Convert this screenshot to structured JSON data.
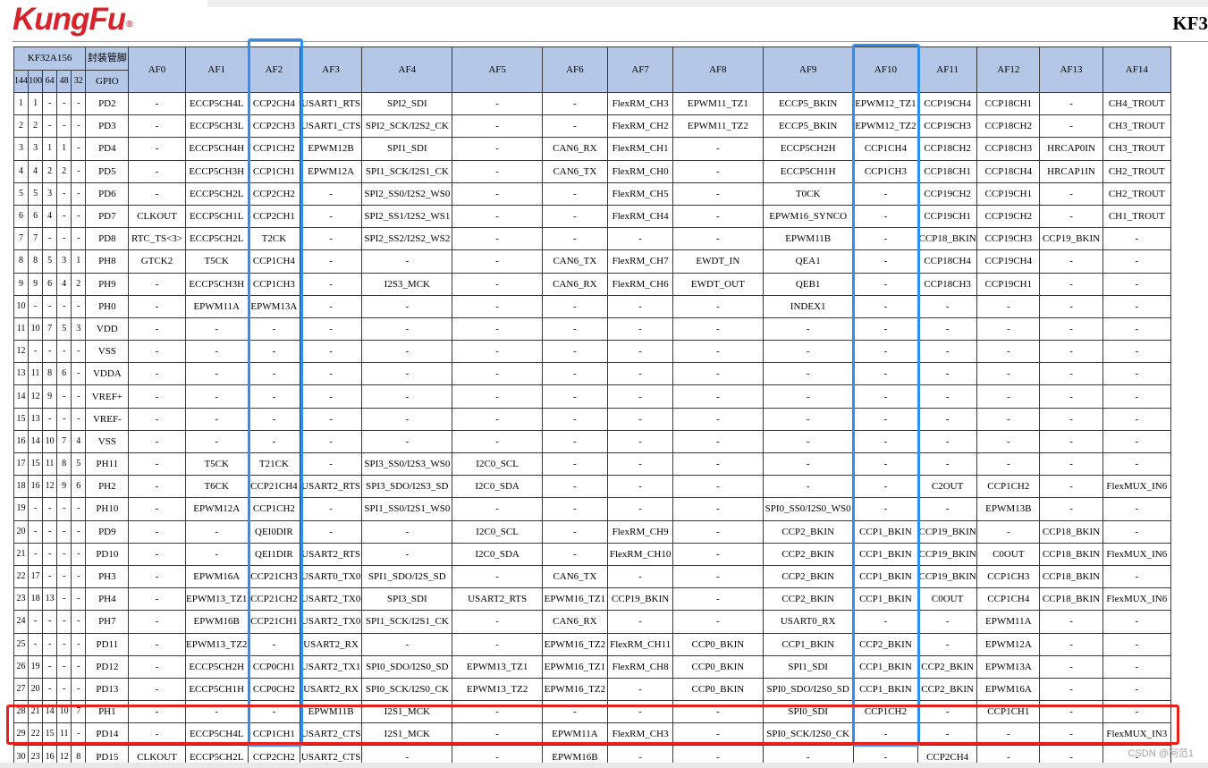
{
  "header": {
    "logo": "KungFu",
    "logo_mark": "®",
    "model": "KF3"
  },
  "table": {
    "package_title": "KF32A156",
    "pin_header_title": "封装管脚",
    "pin_columns": [
      "144",
      "100",
      "64",
      "48",
      "32"
    ],
    "gpio_header": "GPIO",
    "af_headers": [
      "AF0",
      "AF1",
      "AF2",
      "AF3",
      "AF4",
      "AF5",
      "AF6",
      "AF7",
      "AF8",
      "AF9",
      "AF10",
      "AF11",
      "AF12",
      "AF13",
      "AF14"
    ],
    "rows": [
      {
        "pins": [
          "1",
          "1",
          "-",
          "-",
          "-"
        ],
        "gpio": "PD2",
        "af": [
          "-",
          "ECCP5CH4L",
          "CCP2CH4",
          "USART1_RTS",
          "SPI2_SDI",
          "-",
          "-",
          "FlexRM_CH3",
          "EPWM11_TZ1",
          "ECCP5_BKIN",
          "EPWM12_TZ1",
          "CCP19CH4",
          "CCP18CH1",
          "-",
          "CH4_TROUT"
        ]
      },
      {
        "pins": [
          "2",
          "2",
          "-",
          "-",
          "-"
        ],
        "gpio": "PD3",
        "af": [
          "-",
          "ECCP5CH3L",
          "CCP2CH3",
          "USART1_CTS",
          "SPI2_SCK/I2S2_CK",
          "-",
          "-",
          "FlexRM_CH2",
          "EPWM11_TZ2",
          "ECCP5_BKIN",
          "EPWM12_TZ2",
          "CCP19CH3",
          "CCP18CH2",
          "-",
          "CH3_TROUT"
        ]
      },
      {
        "pins": [
          "3",
          "3",
          "1",
          "1",
          "-"
        ],
        "gpio": "PD4",
        "af": [
          "-",
          "ECCP5CH4H",
          "CCP1CH2",
          "EPWM12B",
          "SPI1_SDI",
          "-",
          "CAN6_RX",
          "FlexRM_CH1",
          "-",
          "ECCP5CH2H",
          "CCP1CH4",
          "CCP18CH2",
          "CCP18CH3",
          "HRCAP0IN",
          "CH3_TROUT"
        ]
      },
      {
        "pins": [
          "4",
          "4",
          "2",
          "2",
          "-"
        ],
        "gpio": "PD5",
        "af": [
          "-",
          "ECCP5CH3H",
          "CCP1CH1",
          "EPWM12A",
          "SPI1_SCK/I2S1_CK",
          "-",
          "CAN6_TX",
          "FlexRM_CH0",
          "-",
          "ECCP5CH1H",
          "CCP1CH3",
          "CCP18CH1",
          "CCP18CH4",
          "HRCAP1IN",
          "CH2_TROUT"
        ]
      },
      {
        "pins": [
          "5",
          "5",
          "3",
          "-",
          "-"
        ],
        "gpio": "PD6",
        "af": [
          "-",
          "ECCP5CH2L",
          "CCP2CH2",
          "-",
          "SPI2_SS0/I2S2_WS0",
          "-",
          "-",
          "FlexRM_CH5",
          "-",
          "T0CK",
          "-",
          "CCP19CH2",
          "CCP19CH1",
          "-",
          "CH2_TROUT"
        ]
      },
      {
        "pins": [
          "6",
          "6",
          "4",
          "-",
          "-"
        ],
        "gpio": "PD7",
        "af": [
          "CLKOUT",
          "ECCP5CH1L",
          "CCP2CH1",
          "-",
          "SPI2_SS1/I2S2_WS1",
          "-",
          "-",
          "FlexRM_CH4",
          "-",
          "EPWM16_SYNCO",
          "-",
          "CCP19CH1",
          "CCP19CH2",
          "-",
          "CH1_TROUT"
        ]
      },
      {
        "pins": [
          "7",
          "7",
          "-",
          "-",
          "-"
        ],
        "gpio": "PD8",
        "af": [
          "RTC_TS<3>",
          "ECCP5CH2L",
          "T2CK",
          "-",
          "SPI2_SS2/I2S2_WS2",
          "-",
          "-",
          "-",
          "-",
          "EPWM11B",
          "-",
          "CCP18_BKIN",
          "CCP19CH3",
          "CCP19_BKIN",
          "-"
        ]
      },
      {
        "pins": [
          "8",
          "8",
          "5",
          "3",
          "1"
        ],
        "gpio": "PH8",
        "af": [
          "GTCK2",
          "T5CK",
          "CCP1CH4",
          "-",
          "-",
          "-",
          "CAN6_TX",
          "FlexRM_CH7",
          "EWDT_IN",
          "QEA1",
          "-",
          "CCP18CH4",
          "CCP19CH4",
          "-",
          "-"
        ]
      },
      {
        "pins": [
          "9",
          "9",
          "6",
          "4",
          "2"
        ],
        "gpio": "PH9",
        "af": [
          "-",
          "ECCP5CH3H",
          "CCP1CH3",
          "-",
          "I2S3_MCK",
          "-",
          "CAN6_RX",
          "FlexRM_CH6",
          "EWDT_OUT",
          "QEB1",
          "-",
          "CCP18CH3",
          "CCP19CH1",
          "-",
          "-"
        ]
      },
      {
        "pins": [
          "10",
          "-",
          "-",
          "-",
          "-"
        ],
        "gpio": "PH0",
        "af": [
          "-",
          "EPWM11A",
          "EPWM13A",
          "-",
          "-",
          "-",
          "-",
          "-",
          "-",
          "INDEX1",
          "-",
          "-",
          "-",
          "-",
          "-"
        ]
      },
      {
        "pins": [
          "11",
          "10",
          "7",
          "5",
          "3"
        ],
        "gpio": "VDD",
        "af": [
          "-",
          "-",
          "-",
          "-",
          "-",
          "-",
          "-",
          "-",
          "-",
          "-",
          "-",
          "-",
          "-",
          "-",
          "-"
        ]
      },
      {
        "pins": [
          "12",
          "-",
          "-",
          "-",
          "-"
        ],
        "gpio": "VSS",
        "af": [
          "-",
          "-",
          "-",
          "-",
          "-",
          "-",
          "-",
          "-",
          "-",
          "-",
          "-",
          "-",
          "-",
          "-",
          "-"
        ]
      },
      {
        "pins": [
          "13",
          "11",
          "8",
          "6",
          "-"
        ],
        "gpio": "VDDA",
        "af": [
          "-",
          "-",
          "-",
          "-",
          "-",
          "-",
          "-",
          "-",
          "-",
          "-",
          "-",
          "-",
          "-",
          "-",
          "-"
        ]
      },
      {
        "pins": [
          "14",
          "12",
          "9",
          "-",
          "-"
        ],
        "gpio": "VREF+",
        "af": [
          "-",
          "-",
          "-",
          "-",
          "-",
          "-",
          "-",
          "-",
          "-",
          "-",
          "-",
          "-",
          "-",
          "-",
          "-"
        ]
      },
      {
        "pins": [
          "15",
          "13",
          "-",
          "-",
          "-"
        ],
        "gpio": "VREF-",
        "af": [
          "-",
          "-",
          "-",
          "-",
          "-",
          "-",
          "-",
          "-",
          "-",
          "-",
          "-",
          "-",
          "-",
          "-",
          "-"
        ]
      },
      {
        "pins": [
          "16",
          "14",
          "10",
          "7",
          "4"
        ],
        "gpio": "VSS",
        "af": [
          "-",
          "-",
          "-",
          "-",
          "-",
          "-",
          "-",
          "-",
          "-",
          "-",
          "-",
          "-",
          "-",
          "-",
          "-"
        ]
      },
      {
        "pins": [
          "17",
          "15",
          "11",
          "8",
          "5"
        ],
        "gpio": "PH11",
        "af": [
          "-",
          "T5CK",
          "T21CK",
          "-",
          "SPI3_SS0/I2S3_WS0",
          "I2C0_SCL",
          "-",
          "-",
          "-",
          "-",
          "-",
          "-",
          "-",
          "-",
          "-"
        ]
      },
      {
        "pins": [
          "18",
          "16",
          "12",
          "9",
          "6"
        ],
        "gpio": "PH2",
        "af": [
          "-",
          "T6CK",
          "CCP21CH4",
          "USART2_RTS",
          "SPI3_SDO/I2S3_SD",
          "I2C0_SDA",
          "-",
          "-",
          "-",
          "-",
          "-",
          "C2OUT",
          "CCP1CH2",
          "-",
          "FlexMUX_IN6"
        ]
      },
      {
        "pins": [
          "19",
          "-",
          "-",
          "-",
          "-"
        ],
        "gpio": "PH10",
        "af": [
          "-",
          "EPWM12A",
          "CCP1CH2",
          "-",
          "SPI1_SS0/I2S1_WS0",
          "-",
          "-",
          "-",
          "-",
          "SPI0_SS0/I2S0_WS0",
          "-",
          "-",
          "EPWM13B",
          "-",
          "-"
        ]
      },
      {
        "pins": [
          "20",
          "-",
          "-",
          "-",
          "-"
        ],
        "gpio": "PD9",
        "af": [
          "-",
          "-",
          "QEI0DIR",
          "-",
          "-",
          "I2C0_SCL",
          "-",
          "FlexRM_CH9",
          "-",
          "CCP2_BKIN",
          "CCP1_BKIN",
          "CCP19_BKIN",
          "-",
          "CCP18_BKIN",
          "-"
        ]
      },
      {
        "pins": [
          "21",
          "-",
          "-",
          "-",
          "-"
        ],
        "gpio": "PD10",
        "af": [
          "-",
          "-",
          "QEI1DIR",
          "USART2_RTS",
          "-",
          "I2C0_SDA",
          "-",
          "FlexRM_CH10",
          "-",
          "CCP2_BKIN",
          "CCP1_BKIN",
          "CCP19_BKIN",
          "C0OUT",
          "CCP18_BKIN",
          "FlexMUX_IN6"
        ]
      },
      {
        "pins": [
          "22",
          "17",
          "-",
          "-",
          "-"
        ],
        "gpio": "PH3",
        "af": [
          "-",
          "EPWM16A",
          "CCP21CH3",
          "USART0_TX0",
          "SPI1_SDO/I2S_SD",
          "-",
          "CAN6_TX",
          "-",
          "-",
          "CCP2_BKIN",
          "CCP1_BKIN",
          "CCP19_BKIN",
          "CCP1CH3",
          "CCP18_BKIN",
          "-"
        ]
      },
      {
        "pins": [
          "23",
          "18",
          "13",
          "-",
          "-"
        ],
        "gpio": "PH4",
        "af": [
          "-",
          "EPWM13_TZ1",
          "CCP21CH2",
          "USART2_TX0",
          "SPI3_SDI",
          "USART2_RTS",
          "EPWM16_TZ1",
          "CCP19_BKIN",
          "-",
          "CCP2_BKIN",
          "CCP1_BKIN",
          "C0OUT",
          "CCP1CH4",
          "CCP18_BKIN",
          "FlexMUX_IN6"
        ]
      },
      {
        "pins": [
          "24",
          "-",
          "-",
          "-",
          "-"
        ],
        "gpio": "PH7",
        "af": [
          "-",
          "EPWM16B",
          "CCP21CH1",
          "USART2_TX0",
          "SPI1_SCK/I2S1_CK",
          "-",
          "CAN6_RX",
          "-",
          "-",
          "USART0_RX",
          "-",
          "-",
          "EPWM11A",
          "-",
          "-"
        ]
      },
      {
        "pins": [
          "25",
          "-",
          "-",
          "-",
          "-"
        ],
        "gpio": "PD11",
        "af": [
          "-",
          "EPWM13_TZ2",
          "-",
          "USART2_RX",
          "-",
          "-",
          "EPWM16_TZ2",
          "FlexRM_CH11",
          "CCP0_BKIN",
          "CCP1_BKIN",
          "CCP2_BKIN",
          "-",
          "EPWM12A",
          "-",
          "-"
        ]
      },
      {
        "pins": [
          "26",
          "19",
          "-",
          "-",
          "-"
        ],
        "gpio": "PD12",
        "af": [
          "-",
          "ECCP5CH2H",
          "CCP0CH1",
          "USART2_TX1",
          "SPI0_SDO/I2S0_SD",
          "EPWM13_TZ1",
          "EPWM16_TZ1",
          "FlexRM_CH8",
          "CCP0_BKIN",
          "SPI1_SDI",
          "CCP1_BKIN",
          "CCP2_BKIN",
          "EPWM13A",
          "-",
          "-"
        ]
      },
      {
        "pins": [
          "27",
          "20",
          "-",
          "-",
          "-"
        ],
        "gpio": "PD13",
        "af": [
          "-",
          "ECCP5CH1H",
          "CCP0CH2",
          "USART2_RX",
          "SPI0_SCK/I2S0_CK",
          "EPWM13_TZ2",
          "EPWM16_TZ2",
          "-",
          "CCP0_BKIN",
          "SPI0_SDO/I2S0_SD",
          "CCP1_BKIN",
          "CCP2_BKIN",
          "EPWM16A",
          "-",
          "-"
        ]
      },
      {
        "pins": [
          "28",
          "21",
          "14",
          "10",
          "7"
        ],
        "gpio": "PH1",
        "af": [
          "-",
          "-",
          "-",
          "EPWM11B",
          "I2S1_MCK",
          "-",
          "-",
          "-",
          "-",
          "SPI0_SDI",
          "CCP1CH2",
          "-",
          "CCP1CH1",
          "-",
          "-"
        ]
      },
      {
        "pins": [
          "29",
          "22",
          "15",
          "11",
          "-"
        ],
        "gpio": "PD14",
        "af": [
          "-",
          "ECCP5CH4L",
          "CCP1CH1",
          "USART2_CTS",
          "I2S1_MCK",
          "-",
          "EPWM11A",
          "FlexRM_CH3",
          "-",
          "SPI0_SCK/I2S0_CK",
          "-",
          "-",
          "-",
          "-",
          "FlexMUX_IN3"
        ]
      },
      {
        "pins": [
          "30",
          "23",
          "16",
          "12",
          "8"
        ],
        "gpio": "PD15",
        "af": [
          "CLKOUT",
          "ECCP5CH2L",
          "CCP2CH2",
          "USART2_CTS",
          "-",
          "-",
          "EPWM16B",
          "-",
          "-",
          "-",
          "-",
          "CCP2CH4",
          "-",
          "-",
          "-"
        ]
      }
    ]
  },
  "watermark": "CSDN @阿范1",
  "colors": {
    "header_fill": "#b4c7e7",
    "highlight_blue": "#2f8ff0",
    "highlight_red": "#e8221b",
    "logo_red": "#d7232b"
  }
}
